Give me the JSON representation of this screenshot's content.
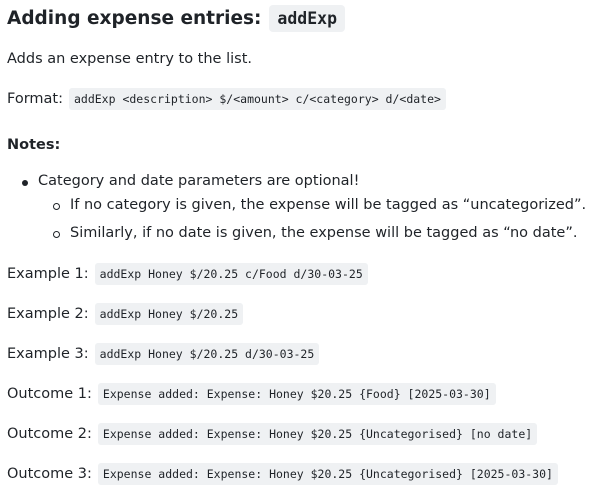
{
  "heading": {
    "text": "Adding expense entries:",
    "command": "addExp"
  },
  "description": "Adds an expense entry to the list.",
  "format": {
    "label": "Format:",
    "code": "addExp <description> $/<amount> c/<category> d/<date>"
  },
  "notes": {
    "title": "Notes:",
    "items": [
      {
        "text": "Category and date parameters are optional!",
        "subitems": [
          "If no category is given, the expense will be tagged as “uncategorized”.",
          "Similarly, if no date is given, the expense will be tagged as “no date”."
        ]
      }
    ]
  },
  "examples": [
    {
      "label": "Example 1:",
      "code": "addExp Honey $/20.25 c/Food d/30-03-25"
    },
    {
      "label": "Example 2:",
      "code": "addExp Honey $/20.25"
    },
    {
      "label": "Example 3:",
      "code": "addExp Honey $/20.25 d/30-03-25"
    }
  ],
  "outcomes": [
    {
      "label": "Outcome 1:",
      "code": "Expense added: Expense: Honey $20.25 {Food} [2025-03-30]"
    },
    {
      "label": "Outcome 2:",
      "code": "Expense added: Expense: Honey $20.25 {Uncategorised} [no date]"
    },
    {
      "label": "Outcome 3:",
      "code": "Expense added: Expense: Honey $20.25 {Uncategorised} [2025-03-30]"
    }
  ]
}
